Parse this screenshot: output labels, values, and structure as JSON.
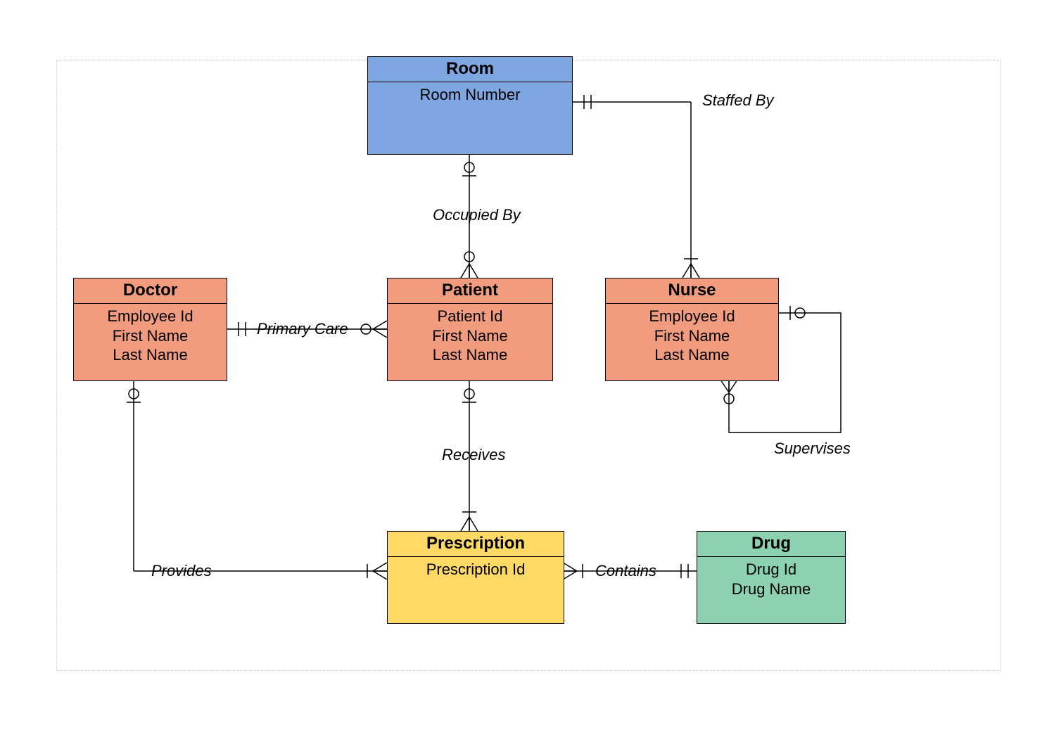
{
  "entities": {
    "room": {
      "title": "Room",
      "attrs": [
        "Room Number"
      ]
    },
    "doctor": {
      "title": "Doctor",
      "attrs": [
        "Employee Id",
        "First Name",
        "Last Name"
      ]
    },
    "patient": {
      "title": "Patient",
      "attrs": [
        "Patient Id",
        "First Name",
        "Last Name"
      ]
    },
    "nurse": {
      "title": "Nurse",
      "attrs": [
        "Employee Id",
        "First Name",
        "Last Name"
      ]
    },
    "prescription": {
      "title": "Prescription",
      "attrs": [
        "Prescription Id"
      ]
    },
    "drug": {
      "title": "Drug",
      "attrs": [
        "Drug Id",
        "Drug Name"
      ]
    }
  },
  "relationships": {
    "staffed_by": "Staffed By",
    "occupied_by": "Occupied By",
    "primary_care": "Primary Care",
    "receives": "Receives",
    "provides": "Provides",
    "contains": "Contains",
    "supervises": "Supervises"
  },
  "colors": {
    "room": "#7ea6e0",
    "person": "#f19c7e",
    "prescription": "#ffd966",
    "drug": "#8cd2b0"
  }
}
